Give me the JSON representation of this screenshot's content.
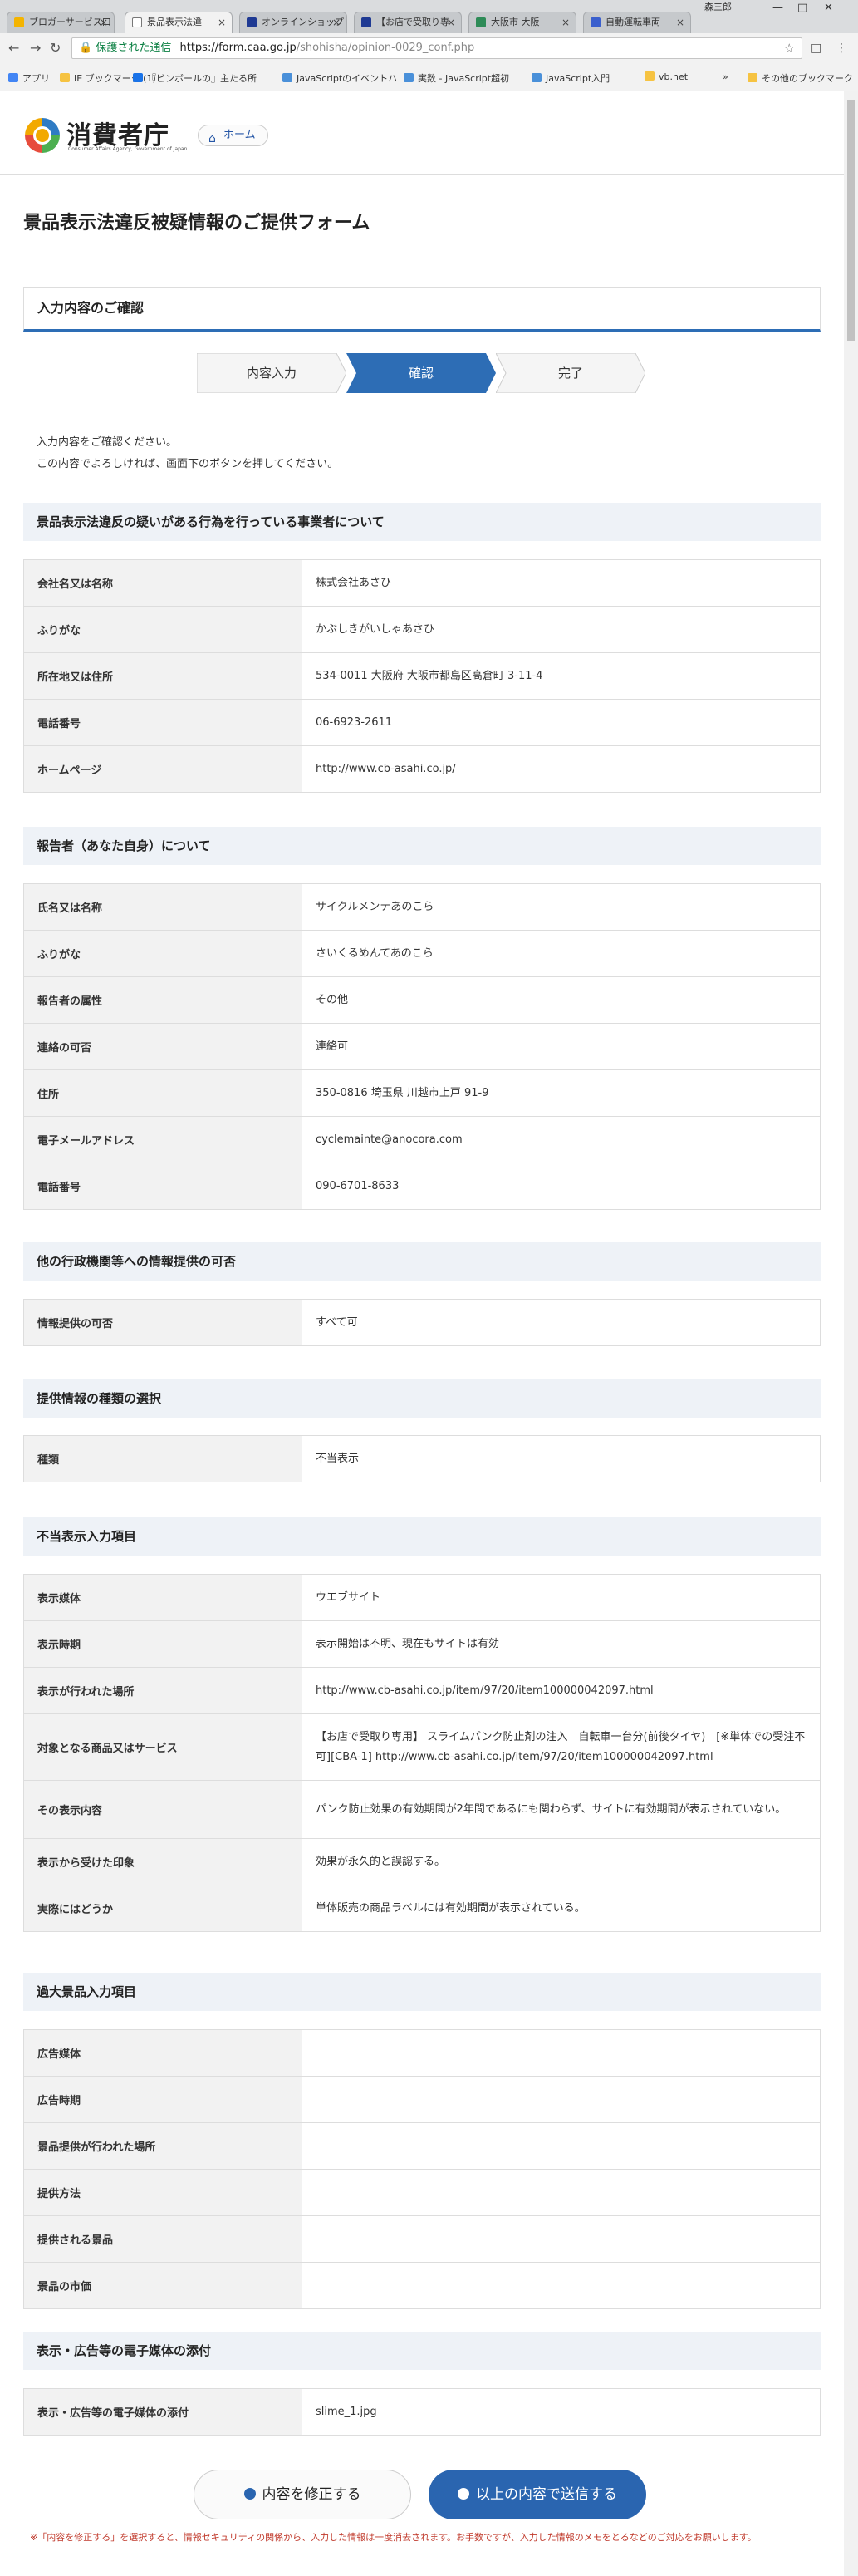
{
  "browser": {
    "tabs": [
      {
        "label": "ブロガーサービス口",
        "color": "#f4b400"
      },
      {
        "label": "景品表示法違",
        "color": "#ffffff"
      },
      {
        "label": "オンラインショップ",
        "color": "#1f3a93"
      },
      {
        "label": "【お店で受取り専",
        "color": "#1f3a93"
      },
      {
        "label": "大阪市 大阪",
        "color": "#2e8b57"
      },
      {
        "label": "自動運転車両",
        "color": "#3a5fcd"
      }
    ],
    "user": "森三郎",
    "secure_label": "保護された通信",
    "url_host": "https://form.caa.go.jp",
    "url_path": "/shohisha/opinion-0029_conf.php",
    "bookmarks": [
      {
        "label": "アプリ",
        "color": "#4285f4"
      },
      {
        "label": "IE ブックマーク (1)",
        "color": "#f6c342"
      },
      {
        "label": "『ビンボールの』主たる所",
        "color": "#1a73e8"
      },
      {
        "label": "JavaScriptのイベントハ",
        "color": "#4a90d9"
      },
      {
        "label": "実数 - JavaScript超初",
        "color": "#4a90d9"
      },
      {
        "label": "JavaScript入門",
        "color": "#4a90d9"
      },
      {
        "label": "vb.net",
        "color": "#f6c342"
      }
    ],
    "other_bookmarks": "その他のブックマーク"
  },
  "site": {
    "logo_text": "消費者庁",
    "logo_en": "Consumer Affairs Agency, Government of Japan",
    "home_label": "ホーム"
  },
  "page_title": "景品表示法違反被疑情報のご提供フォーム",
  "section_title": "入力内容のご確認",
  "steps": [
    "内容入力",
    "確認",
    "完了"
  ],
  "intro": [
    "入力内容をご確認ください。",
    "この内容でよろしければ、画面下のボタンを押してください。"
  ],
  "groups": [
    {
      "title": "景品表示法違反の疑いがある行為を行っている事業者について",
      "rows": [
        {
          "k": "会社名又は名称",
          "v": "株式会社あさひ"
        },
        {
          "k": "ふりがな",
          "v": "かぶしきがいしゃあさひ"
        },
        {
          "k": "所在地又は住所",
          "v": "534-0011 大阪府 大阪市都島区高倉町 3-11-4"
        },
        {
          "k": "電話番号",
          "v": "06-6923-2611"
        },
        {
          "k": "ホームページ",
          "v": "http://www.cb-asahi.co.jp/"
        }
      ]
    },
    {
      "title": "報告者（あなた自身）について",
      "rows": [
        {
          "k": "氏名又は名称",
          "v": "サイクルメンテあのこら"
        },
        {
          "k": "ふりがな",
          "v": "さいくるめんてあのこら"
        },
        {
          "k": "報告者の属性",
          "v": "その他"
        },
        {
          "k": "連絡の可否",
          "v": "連絡可"
        },
        {
          "k": "住所",
          "v": "350-0816 埼玉県 川越市上戸 91-9"
        },
        {
          "k": "電子メールアドレス",
          "v": "cyclemainte@anocora.com"
        },
        {
          "k": "電話番号",
          "v": "090-6701-8633"
        }
      ]
    },
    {
      "title": "他の行政機関等への情報提供の可否",
      "rows": [
        {
          "k": "情報提供の可否",
          "v": "すべて可"
        }
      ]
    },
    {
      "title": "提供情報の種類の選択",
      "rows": [
        {
          "k": "種類",
          "v": "不当表示"
        }
      ]
    },
    {
      "title": "不当表示入力項目",
      "rows": [
        {
          "k": "表示媒体",
          "v": "ウエブサイト"
        },
        {
          "k": "表示時期",
          "v": "表示開始は不明、現在もサイトは有効"
        },
        {
          "k": "表示が行われた場所",
          "v": "http://www.cb-asahi.co.jp/item/97/20/item100000042097.html"
        },
        {
          "k": "対象となる商品又はサービス",
          "v": "【お店で受取り専用】 スライムパンク防止剤の注入　自転車一台分(前後タイヤ)　[※単体での受注不可][CBA-1] http://www.cb-asahi.co.jp/item/97/20/item100000042097.html"
        },
        {
          "k": "その表示内容",
          "v": "パンク防止効果の有効期間が2年間であるにも関わらず、サイトに有効期間が表示されていない。"
        },
        {
          "k": "表示から受けた印象",
          "v": "効果が永久的と誤認する。"
        },
        {
          "k": "実際にはどうか",
          "v": "単体販売の商品ラベルには有効期間が表示されている。"
        }
      ]
    },
    {
      "title": "過大景品入力項目",
      "rows": [
        {
          "k": "広告媒体",
          "v": ""
        },
        {
          "k": "広告時期",
          "v": ""
        },
        {
          "k": "景品提供が行われた場所",
          "v": ""
        },
        {
          "k": "提供方法",
          "v": ""
        },
        {
          "k": "提供される景品",
          "v": ""
        },
        {
          "k": "景品の市価",
          "v": ""
        }
      ]
    },
    {
      "title": "表示・広告等の電子媒体の添付",
      "rows": [
        {
          "k": "表示・広告等の電子媒体の添付",
          "v": "slime_1.jpg"
        }
      ]
    }
  ],
  "buttons": {
    "fix": "内容を修正する",
    "send": "以上の内容で送信する"
  },
  "note": "※「内容を修正する」を選択すると、情報セキュリティの関係から、入力した情報は一度消去されます。お手数ですが、入力した情報のメモをとるなどのご対応をお願いします。"
}
